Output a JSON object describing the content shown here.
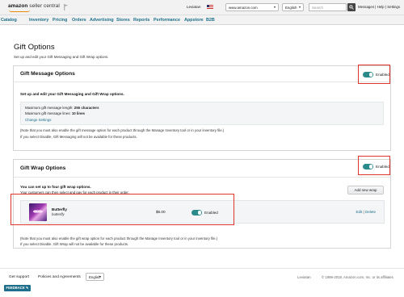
{
  "header": {
    "logo_bold": "amazon",
    "logo_light": "seller central",
    "account_name": "Leviatan",
    "marketplace": "www.amazon.com",
    "language": "English",
    "search_placeholder": "Search",
    "links": "Messages | Help | Settings"
  },
  "nav": {
    "items": [
      "Catalog",
      "Inventory",
      "Pricing",
      "Orders",
      "Advertising",
      "Stores",
      "Reports",
      "Performance",
      "Appstore",
      "B2B"
    ]
  },
  "page": {
    "title": "Gift Options",
    "subtitle": "Set up and edit your Gift Messaging and Gift Wrap options."
  },
  "gift_message": {
    "title": "Gift Message Options",
    "toggle_label": "Enabled",
    "intro": "Set up and edit your Gift Messaging and Gift Wrap options.",
    "max_length_label": "Maximum gift message length:",
    "max_length_value": "255 characters",
    "max_lines_label": "Maximum gift message lines:",
    "max_lines_value": "10 lines",
    "change_link": "Change Settings",
    "note1": "(Note that you must also enable the gift message option for each product through the Manage Inventory tool or in your inventory file.)",
    "note2": "If you select Disable, Gift Messaging will not be available for these products."
  },
  "gift_wrap": {
    "title": "Gift Wrap Options",
    "toggle_label": "Enabled",
    "intro_bold": "You can set up to four gift wrap options.",
    "intro": "Your customers can then select and pay for each product in their order.",
    "add_button": "Add new wrap",
    "item": {
      "name": "Butterfly",
      "subtitle": "butterfly",
      "price": "$5.00",
      "toggle_label": "Enabled",
      "edit": "Edit",
      "separator": "|",
      "delete": "Delete"
    },
    "note1": "(Note that you must also enable the gift wrap option for each product through the Manage Inventory tool or in your inventory file.)",
    "note2": "If you select Disable, Gift Wrap will not be available for these products."
  },
  "footer": {
    "get_support": "Get support",
    "policies": "Policies and Agreements",
    "language": "English",
    "user": "Leviatan",
    "copyright": "© 1999-2018, Amazon.com, Inc. or its affiliates",
    "feedback": "FEEDBACK"
  },
  "colors": {
    "accent_teal": "#2b8a8a",
    "link": "#1d6f8a",
    "highlight_red": "#e0352b"
  },
  "icons": [
    "flag-icon",
    "us-flag-icon",
    "search-icon",
    "chevron-down-icon",
    "feedback-icon"
  ]
}
